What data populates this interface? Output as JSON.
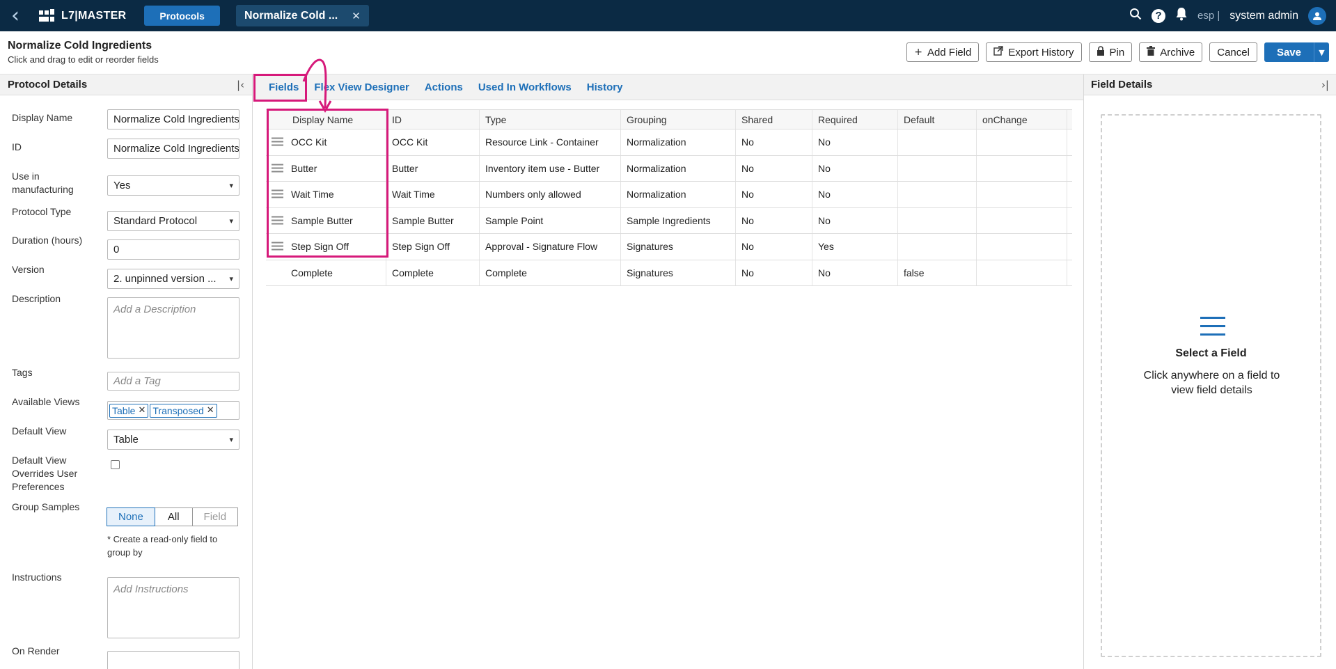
{
  "topbar": {
    "logo": "L7|MASTER",
    "protocols_label": "Protocols",
    "doc_tab": "Normalize Cold ...",
    "lang": "esp |",
    "user": "system admin"
  },
  "header": {
    "title": "Normalize Cold Ingredients",
    "subtitle": "Click and drag to edit or reorder fields",
    "buttons": {
      "add_field": "Add Field",
      "export_history": "Export History",
      "pin": "Pin",
      "archive": "Archive",
      "cancel": "Cancel",
      "save": "Save"
    }
  },
  "left_panel": {
    "title": "Protocol Details",
    "fields": {
      "display_name": {
        "label": "Display Name",
        "value": "Normalize Cold Ingredients"
      },
      "id": {
        "label": "ID",
        "value": "Normalize Cold Ingredients"
      },
      "use_in_manufacturing": {
        "label": "Use in manufacturing",
        "value": "Yes"
      },
      "protocol_type": {
        "label": "Protocol Type",
        "value": "Standard Protocol"
      },
      "duration": {
        "label": "Duration (hours)",
        "value": "0"
      },
      "version": {
        "label": "Version",
        "value": "2. unpinned version ..."
      },
      "description": {
        "label": "Description",
        "placeholder": "Add a Description"
      },
      "tags": {
        "label": "Tags",
        "placeholder": "Add a Tag"
      },
      "available_views": {
        "label": "Available Views",
        "chips": [
          "Table",
          "Transposed"
        ]
      },
      "default_view": {
        "label": "Default View",
        "value": "Table"
      },
      "default_view_overrides": {
        "label": "Default View Overrides User Preferences"
      },
      "group_samples": {
        "label": "Group Samples",
        "options": [
          "None",
          "All",
          "Field"
        ],
        "selected": "None",
        "note": "* Create a read-only field to group by"
      },
      "instructions": {
        "label": "Instructions",
        "placeholder": "Add Instructions"
      },
      "on_render": {
        "label": "On Render"
      }
    }
  },
  "tabs": [
    "Fields",
    "Flex View Designer",
    "Actions",
    "Used In Workflows",
    "History"
  ],
  "grid": {
    "columns": [
      "Display Name",
      "ID",
      "Type",
      "Grouping",
      "Shared",
      "Required",
      "Default",
      "onChange"
    ],
    "rows": [
      {
        "name": "OCC Kit",
        "id": "OCC Kit",
        "type": "Resource Link - Container",
        "grouping": "Normalization",
        "shared": "No",
        "required": "No",
        "default": "",
        "onchange": "",
        "draggable": true
      },
      {
        "name": "Butter",
        "id": "Butter",
        "type": "Inventory item use - Butter",
        "grouping": "Normalization",
        "shared": "No",
        "required": "No",
        "default": "",
        "onchange": "",
        "draggable": true
      },
      {
        "name": "Wait Time",
        "id": "Wait Time",
        "type": "Numbers only allowed",
        "grouping": "Normalization",
        "shared": "No",
        "required": "No",
        "default": "",
        "onchange": "",
        "draggable": true
      },
      {
        "name": "Sample Butter",
        "id": "Sample Butter",
        "type": "Sample Point",
        "grouping": "Sample Ingredients",
        "shared": "No",
        "required": "No",
        "default": "",
        "onchange": "",
        "draggable": true
      },
      {
        "name": "Step Sign Off",
        "id": "Step Sign Off",
        "type": "Approval - Signature Flow",
        "grouping": "Signatures",
        "shared": "No",
        "required": "Yes",
        "default": "",
        "onchange": "",
        "draggable": true
      },
      {
        "name": "Complete",
        "id": "Complete",
        "type": "Complete",
        "grouping": "Signatures",
        "shared": "No",
        "required": "No",
        "default": "false",
        "onchange": "",
        "draggable": false
      }
    ]
  },
  "right_panel": {
    "title": "Field Details",
    "empty_title": "Select a Field",
    "empty_text": "Click anywhere on a field to view field details"
  },
  "colors": {
    "topbar": "#0b2a44",
    "accent": "#1d6fb8",
    "highlight": "#d6197a"
  }
}
